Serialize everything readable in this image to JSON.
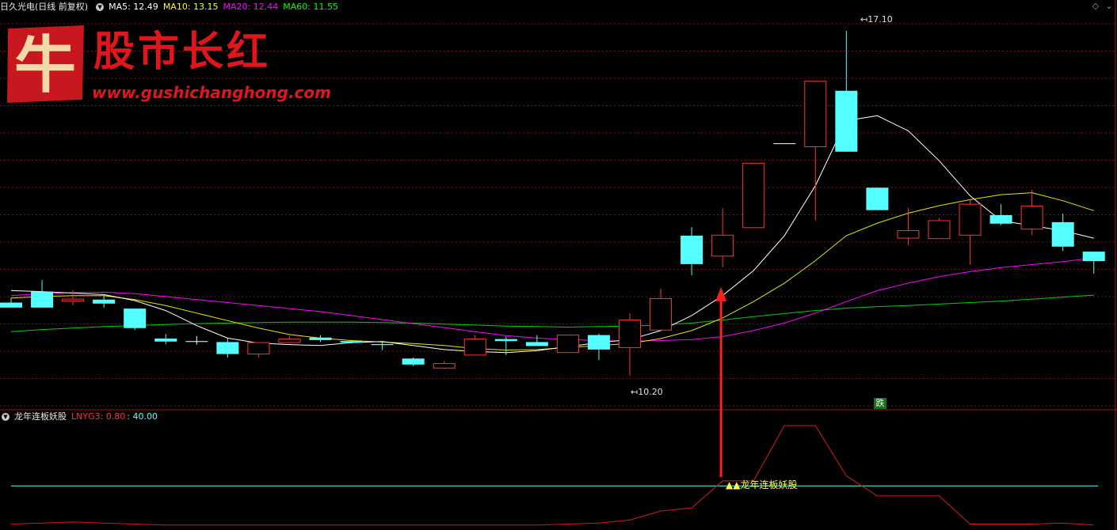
{
  "main_header": {
    "stock_title": "日久光电(日线 前复权)",
    "indicators": [
      {
        "label": "MA5: 12.49",
        "color": "#ffffff"
      },
      {
        "label": "MA10: 13.15",
        "color": "#ffff00"
      },
      {
        "label": "MA20: 12.44",
        "color": "#ff00ff"
      },
      {
        "label": "MA60: 11.55",
        "color": "#00ff00"
      }
    ]
  },
  "watermark": {
    "glyph": "牛",
    "title": "股市长红",
    "url": "www.gushichanghong.com"
  },
  "chart_data": {
    "type": "candlestick",
    "ylim": [
      9.8,
      17.4
    ],
    "candles": [
      {
        "o": 11.66,
        "h": 11.76,
        "l": 11.56,
        "c": 11.56
      },
      {
        "o": 11.88,
        "h": 12.11,
        "l": 11.56,
        "c": 11.56
      },
      {
        "o": 11.69,
        "h": 11.91,
        "l": 11.61,
        "c": 11.73
      },
      {
        "o": 11.72,
        "h": 11.79,
        "l": 11.56,
        "c": 11.64
      },
      {
        "o": 11.54,
        "h": 11.54,
        "l": 11.11,
        "c": 11.15
      },
      {
        "o": 10.94,
        "h": 11.03,
        "l": 10.83,
        "c": 10.88
      },
      {
        "o": 10.88,
        "h": 10.99,
        "l": 10.82,
        "c": 10.88
      },
      {
        "o": 10.87,
        "h": 10.94,
        "l": 10.56,
        "c": 10.63
      },
      {
        "o": 10.63,
        "h": 10.86,
        "l": 10.56,
        "c": 10.86
      },
      {
        "o": 10.86,
        "h": 10.99,
        "l": 10.86,
        "c": 10.93
      },
      {
        "o": 10.96,
        "h": 11.01,
        "l": 10.87,
        "c": 10.91
      },
      {
        "o": 10.89,
        "h": 10.91,
        "l": 10.84,
        "c": 10.86
      },
      {
        "o": 10.83,
        "h": 10.87,
        "l": 10.71,
        "c": 10.81
      },
      {
        "o": 10.54,
        "h": 10.56,
        "l": 10.39,
        "c": 10.42
      },
      {
        "o": 10.35,
        "h": 10.49,
        "l": 10.33,
        "c": 10.44
      },
      {
        "o": 10.61,
        "h": 11.01,
        "l": 10.61,
        "c": 10.93
      },
      {
        "o": 10.93,
        "h": 10.98,
        "l": 10.61,
        "c": 10.89
      },
      {
        "o": 10.87,
        "h": 11.01,
        "l": 10.84,
        "c": 10.79
      },
      {
        "o": 10.66,
        "h": 11.01,
        "l": 10.66,
        "c": 11.01
      },
      {
        "o": 11.01,
        "h": 11.04,
        "l": 10.51,
        "c": 10.72
      },
      {
        "o": 10.76,
        "h": 11.44,
        "l": 10.2,
        "c": 11.31
      },
      {
        "o": 11.11,
        "h": 11.94,
        "l": 11.11,
        "c": 11.74
      },
      {
        "o": 13.0,
        "h": 13.17,
        "l": 12.21,
        "c": 12.43
      },
      {
        "o": 12.59,
        "h": 13.55,
        "l": 12.37,
        "c": 13.01
      },
      {
        "o": 13.16,
        "h": 14.45,
        "l": 13.16,
        "c": 14.45
      },
      {
        "o": 14.84,
        "h": 14.84,
        "l": 14.84,
        "c": 14.84
      },
      {
        "o": 14.78,
        "h": 16.09,
        "l": 13.31,
        "c": 16.09
      },
      {
        "o": 15.9,
        "h": 17.1,
        "l": 14.68,
        "c": 14.68
      },
      {
        "o": 13.96,
        "h": 13.96,
        "l": 13.51,
        "c": 13.51
      },
      {
        "o": 12.95,
        "h": 13.55,
        "l": 12.81,
        "c": 13.1
      },
      {
        "o": 12.94,
        "h": 13.35,
        "l": 12.94,
        "c": 13.3
      },
      {
        "o": 13.01,
        "h": 13.72,
        "l": 12.42,
        "c": 13.63
      },
      {
        "o": 13.41,
        "h": 13.63,
        "l": 13.21,
        "c": 13.24
      },
      {
        "o": 13.13,
        "h": 13.92,
        "l": 13.01,
        "c": 13.59
      },
      {
        "o": 13.27,
        "h": 13.44,
        "l": 12.69,
        "c": 12.78
      },
      {
        "o": 12.68,
        "h": 12.68,
        "l": 12.24,
        "c": 12.49
      }
    ],
    "ma5": [
      11.9,
      11.88,
      11.85,
      11.82,
      11.7,
      11.5,
      11.2,
      10.95,
      10.85,
      10.82,
      10.8,
      10.86,
      10.88,
      10.8,
      10.72,
      10.68,
      10.66,
      10.7,
      10.78,
      10.86,
      10.92,
      11.1,
      11.4,
      11.8,
      12.3,
      13.0,
      14.0,
      15.3,
      15.4,
      15.1,
      14.5,
      13.8,
      13.3,
      13.2,
      13.1,
      12.95
    ],
    "ma10": [
      11.75,
      11.78,
      11.8,
      11.8,
      11.72,
      11.6,
      11.45,
      11.3,
      11.15,
      11.02,
      10.95,
      10.9,
      10.87,
      10.84,
      10.8,
      10.74,
      10.71,
      10.72,
      10.76,
      10.8,
      10.84,
      10.94,
      11.1,
      11.35,
      11.68,
      12.05,
      12.5,
      13.0,
      13.25,
      13.45,
      13.6,
      13.72,
      13.82,
      13.86,
      13.7,
      13.5
    ],
    "ma20": [
      11.8,
      11.84,
      11.86,
      11.87,
      11.84,
      11.78,
      11.72,
      11.66,
      11.6,
      11.54,
      11.48,
      11.4,
      11.32,
      11.24,
      11.16,
      11.08,
      11.0,
      10.95,
      10.92,
      10.9,
      10.89,
      10.9,
      10.92,
      10.98,
      11.1,
      11.25,
      11.45,
      11.68,
      11.9,
      12.05,
      12.18,
      12.28,
      12.36,
      12.42,
      12.48,
      12.55
    ],
    "ma60": [
      11.08,
      11.12,
      11.15,
      11.18,
      11.2,
      11.22,
      11.24,
      11.25,
      11.26,
      11.27,
      11.27,
      11.27,
      11.26,
      11.25,
      11.23,
      11.21,
      11.19,
      11.18,
      11.17,
      11.18,
      11.19,
      11.21,
      11.25,
      11.31,
      11.38,
      11.44,
      11.5,
      11.55,
      11.58,
      11.6,
      11.63,
      11.66,
      11.69,
      11.73,
      11.77,
      11.81
    ],
    "high_label": "17.10",
    "low_label": "10.20",
    "tag_label": "跌"
  },
  "sub_header": {
    "indicator_name": "龙年连板妖股",
    "lnyg3_label": "LNYG3: 0.80",
    "threshold_label": ": 40.00"
  },
  "sub_chart": {
    "ylim": [
      0,
      100
    ],
    "threshold": 40,
    "signal_label": "▲▲龙年连板妖股",
    "lnyg3_values": [
      2,
      3,
      4,
      3,
      2,
      1,
      1,
      1,
      1,
      1,
      1,
      1,
      1,
      1,
      1,
      1,
      1,
      1,
      2,
      3,
      6,
      15,
      18,
      45,
      45,
      100,
      100,
      50,
      30,
      30,
      30,
      2,
      2,
      2,
      3,
      1
    ]
  },
  "colors": {
    "up": "#ff3232",
    "down": "#54ffff",
    "grid": "#7a1010",
    "divider": "#a01818",
    "arrow": "#ff1e1e",
    "threshold_line": "#54ffff",
    "indicator_line": "#d81818"
  }
}
